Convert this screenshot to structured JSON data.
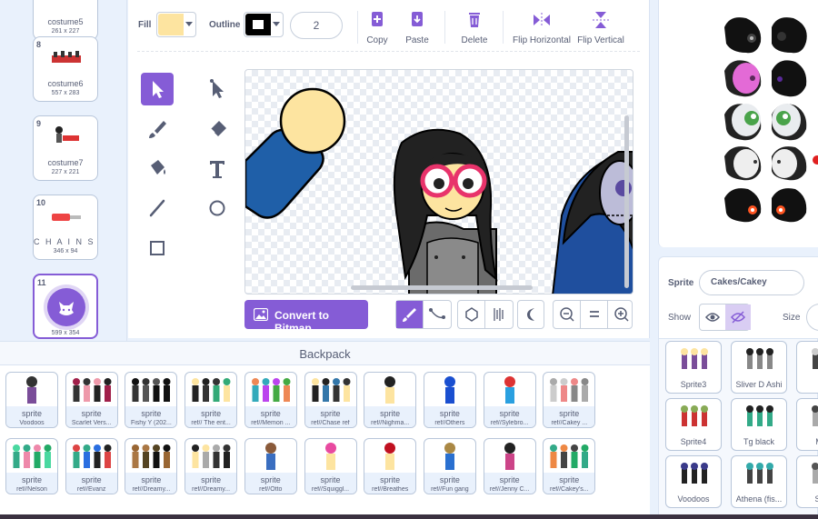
{
  "costumes": [
    {
      "number": "",
      "name": "costume5",
      "size": "261 x 227"
    },
    {
      "number": "8",
      "name": "costume6",
      "size": "557 x 283"
    },
    {
      "number": "9",
      "name": "costume7",
      "size": "227 x 221"
    },
    {
      "number": "10",
      "name": "C H A I N S ...",
      "size": "346 x 94"
    },
    {
      "number": "11",
      "name": "",
      "size": "599 x 354"
    }
  ],
  "toolbar": {
    "fill_label": "Fill",
    "outline_label": "Outline",
    "fill_color": "#fde4a0",
    "outline_color": "#000000",
    "stroke_width": "2",
    "copy_label": "Copy",
    "paste_label": "Paste",
    "delete_label": "Delete",
    "flip_h_label": "Flip Horizontal",
    "flip_v_label": "Flip Vertical"
  },
  "tools": [
    "select-icon",
    "reshape-icon",
    "brush-icon",
    "eraser-icon",
    "fill-icon",
    "text-icon",
    "line-icon",
    "circle-icon",
    "rectangle-icon"
  ],
  "canvas_footer": {
    "convert_label": "Convert to Bitmap"
  },
  "backpack": {
    "title": "Backpack",
    "items": [
      {
        "type": "sprite",
        "name": "Voodoos"
      },
      {
        "type": "sprite",
        "name": "Scarlet Vers..."
      },
      {
        "type": "sprite",
        "name": "Fishy Y (202..."
      },
      {
        "type": "sprite",
        "name": "ref// The ent..."
      },
      {
        "type": "sprite",
        "name": "ref//Memon ..."
      },
      {
        "type": "sprite",
        "name": "ref//Chase ref"
      },
      {
        "type": "sprite",
        "name": "ref//Nighma..."
      },
      {
        "type": "sprite",
        "name": "ref//Others"
      },
      {
        "type": "sprite",
        "name": "ref//Sylebro..."
      },
      {
        "type": "sprite",
        "name": "ref//Cakey ..."
      },
      {
        "type": "sprite",
        "name": "ref//Nelson"
      },
      {
        "type": "sprite",
        "name": "ref//Evanz"
      },
      {
        "type": "sprite",
        "name": "ref//Dreamy..."
      },
      {
        "type": "sprite",
        "name": "ref//Dreamy..."
      },
      {
        "type": "sprite",
        "name": "ref//Otto"
      },
      {
        "type": "sprite",
        "name": "ref//Squiggl..."
      },
      {
        "type": "sprite",
        "name": "ref//Breathes"
      },
      {
        "type": "sprite",
        "name": "ref//Fun gang"
      },
      {
        "type": "sprite",
        "name": "ref//Jenny C..."
      },
      {
        "type": "sprite",
        "name": "ref//Cakey's..."
      }
    ]
  },
  "sprite_info": {
    "sprite_label": "Sprite",
    "sprite_name": "Cakes/Cakey",
    "show_label": "Show",
    "size_label": "Size"
  },
  "sprite_list": [
    {
      "name": "Sprite3"
    },
    {
      "name": "Sliver D Ashi"
    },
    {
      "name": "E"
    },
    {
      "name": "Sprite4"
    },
    {
      "name": "Tg black"
    },
    {
      "name": "Moni"
    },
    {
      "name": "Voodoos"
    },
    {
      "name": "Athena (fis..."
    },
    {
      "name": "Sarid"
    }
  ],
  "colors": {
    "accent": "#855cd6",
    "panel": "#e9f1fc",
    "text": "#575e75"
  }
}
